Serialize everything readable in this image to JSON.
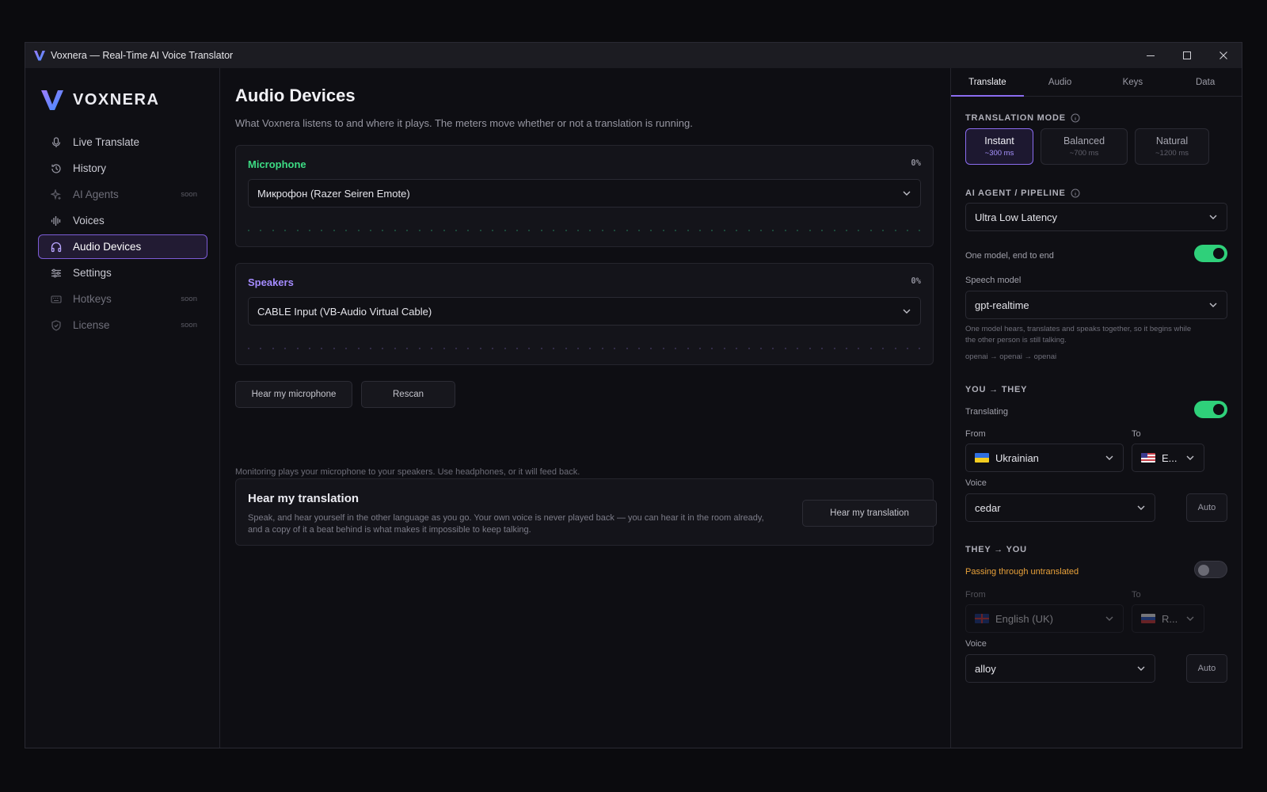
{
  "window": {
    "title": "Voxnera — Real-Time AI Voice Translator"
  },
  "brand": {
    "name": "VOXNERA"
  },
  "nav": {
    "items": [
      {
        "label": "Live Translate",
        "icon": "microphone-icon",
        "badge": ""
      },
      {
        "label": "History",
        "icon": "history-icon",
        "badge": ""
      },
      {
        "label": "AI Agents",
        "icon": "sparkle-icon",
        "badge": "soon"
      },
      {
        "label": "Voices",
        "icon": "waveform-icon",
        "badge": ""
      },
      {
        "label": "Audio Devices",
        "icon": "headphones-icon",
        "badge": ""
      },
      {
        "label": "Settings",
        "icon": "sliders-icon",
        "badge": ""
      },
      {
        "label": "Hotkeys",
        "icon": "keyboard-icon",
        "badge": "soon"
      },
      {
        "label": "License",
        "icon": "shield-icon",
        "badge": "soon"
      }
    ],
    "active": "Audio Devices"
  },
  "main": {
    "title": "Audio Devices",
    "subtitle": "What Voxnera listens to and where it plays. The meters move whether or not a translation is running.",
    "microphone": {
      "label": "Microphone",
      "level": "0%",
      "device": "Микрофон (Razer Seiren Emote)"
    },
    "speakers": {
      "label": "Speakers",
      "level": "0%",
      "device": "CABLE Input (VB-Audio Virtual Cable)"
    },
    "buttons": {
      "hear_mic": "Hear my microphone",
      "rescan": "Rescan"
    },
    "monitor_note": "Monitoring plays your microphone to your speakers. Use headphones, or it will feed back.",
    "hear_translation": {
      "title": "Hear my translation",
      "description": "Speak, and hear yourself in the other language as you go. Your own voice is never played back — you can hear it in the room already, and a copy of it a beat behind is what makes it impossible to keep talking.",
      "button": "Hear my translation"
    }
  },
  "panel": {
    "tabs": [
      "Translate",
      "Audio",
      "Keys",
      "Data"
    ],
    "active_tab": "Translate",
    "translation_mode": {
      "heading": "TRANSLATION MODE",
      "options": [
        {
          "label": "Instant",
          "latency": "~300 ms"
        },
        {
          "label": "Balanced",
          "latency": "~700 ms"
        },
        {
          "label": "Natural",
          "latency": "~1200 ms"
        }
      ],
      "selected": "Instant"
    },
    "pipeline": {
      "heading": "AI AGENT / PIPELINE",
      "value": "Ultra Low Latency",
      "one_model_label": "One model, end to end",
      "one_model_on": true,
      "speech_model_label": "Speech model",
      "speech_model": "gpt-realtime",
      "description": "One model hears, translates and speaks together, so it begins while the other person is still talking.",
      "route": "openai → openai → openai"
    },
    "you_they": {
      "heading": "YOU → THEY",
      "status": "Translating",
      "enabled": true,
      "from_label": "From",
      "to_label": "To",
      "from": "Ukrainian",
      "to": "E...",
      "voice_label": "Voice",
      "voice": "cedar",
      "auto": "Auto"
    },
    "they_you": {
      "heading": "THEY → YOU",
      "status": "Passing through untranslated",
      "enabled": false,
      "from_label": "From",
      "to_label": "To",
      "from": "English (UK)",
      "to": "R...",
      "voice_label": "Voice",
      "voice": "alloy",
      "auto": "Auto"
    }
  },
  "colors": {
    "accent": "#8b6cf0",
    "microphone": "#3ddc84",
    "speakers": "#a58cff",
    "toggle_on": "#2fd07a",
    "warning": "#e8a13a"
  }
}
